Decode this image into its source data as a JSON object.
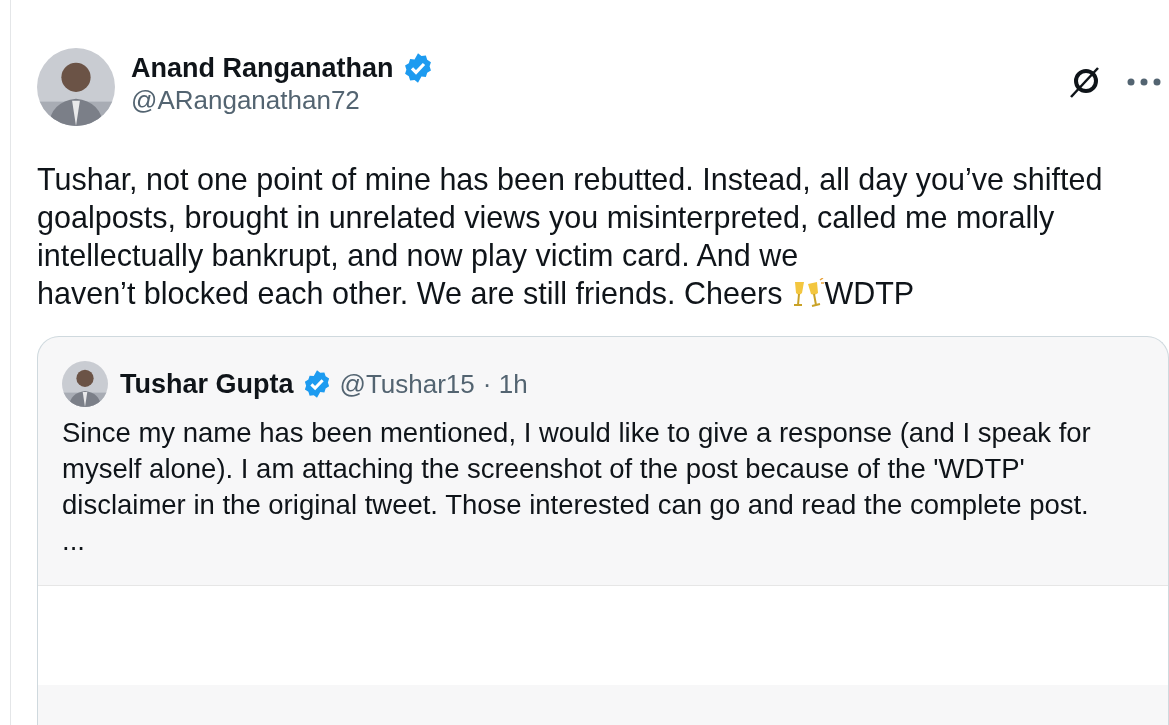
{
  "post": {
    "author": {
      "name": "Anand Ranganathan",
      "verified": true,
      "handle": "@ARanganathan72"
    },
    "text": "Tushar, not one point of mine has been rebutted. Instead, all day you’ve shifted goalposts, brought in unrelated views you misinterpreted, called me morally intellectually bankrupt, and now play victim card. And we",
    "text_last_line": "haven’t blocked each other. We are still friends. Cheers",
    "text_after_emoji": "WDTP",
    "quoted": {
      "author": {
        "name": "Tushar Gupta",
        "verified": true,
        "handle": "@Tushar15",
        "time": "· 1h"
      },
      "text": "Since my name has been mentioned, I would like to give a response (and I speak for myself alone). I am attaching the screenshot of the post because of the 'WDTP' disclaimer in the original tweet. Those interested can go and read the complete post.",
      "more": "..."
    }
  }
}
